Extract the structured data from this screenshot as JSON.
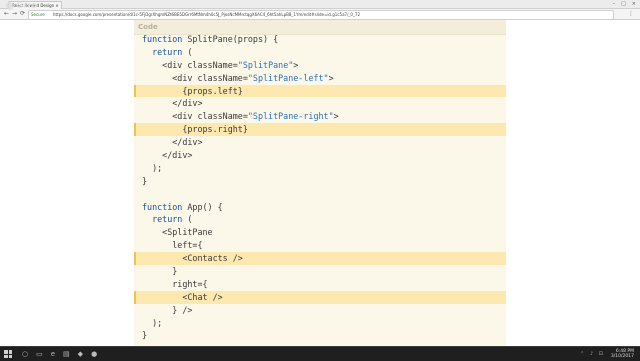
{
  "browser": {
    "tab_title": "React Rewind Design ×",
    "tab_close": "×",
    "window_buttons": [
      "–",
      "□",
      "×"
    ],
    "nav": [
      "←",
      "→",
      "⟳"
    ],
    "secure_label": "Secure",
    "url": "https://docs.google.com/presentation/d/1c-5FjDgrXhgmNZt6BE5DGrr6MtNm4h0c5J_PjosNcMMrctqgX6AC4_6ht5ahLpB8_1Ym/edit#slide=id.g1c5a7/_0_72",
    "menu": "⋮",
    "overlay_logo": "Gilo"
  },
  "panel": {
    "title": "Code"
  },
  "code_lines": [
    {
      "text": "function SplitPane(props) {",
      "hl": false
    },
    {
      "text": "  return (",
      "hl": false
    },
    {
      "text": "    <div className=\"SplitPane\">",
      "hl": false
    },
    {
      "text": "      <div className=\"SplitPane-left\">",
      "hl": false
    },
    {
      "text": "        {props.left}",
      "hl": true
    },
    {
      "text": "      </div>",
      "hl": false
    },
    {
      "text": "      <div className=\"SplitPane-right\">",
      "hl": false
    },
    {
      "text": "        {props.right}",
      "hl": true
    },
    {
      "text": "      </div>",
      "hl": false
    },
    {
      "text": "    </div>",
      "hl": false
    },
    {
      "text": "  );",
      "hl": false
    },
    {
      "text": "}",
      "hl": false
    },
    {
      "text": "",
      "hl": false
    },
    {
      "text": "function App() {",
      "hl": false
    },
    {
      "text": "  return (",
      "hl": false
    },
    {
      "text": "    <SplitPane",
      "hl": false
    },
    {
      "text": "      left={",
      "hl": false
    },
    {
      "text": "        <Contacts />",
      "hl": true
    },
    {
      "text": "      }",
      "hl": false
    },
    {
      "text": "      right={",
      "hl": false
    },
    {
      "text": "        <Chat />",
      "hl": true
    },
    {
      "text": "      } />",
      "hl": false
    },
    {
      "text": "  );",
      "hl": false
    },
    {
      "text": "}",
      "hl": false
    }
  ],
  "taskbar": {
    "icons": [
      "○",
      "▭",
      "e",
      "▤",
      "◆",
      "●"
    ],
    "tray_icons": "⌃ ♪ ⊡",
    "time": "6:48 PM",
    "date": "3/10/2017"
  }
}
